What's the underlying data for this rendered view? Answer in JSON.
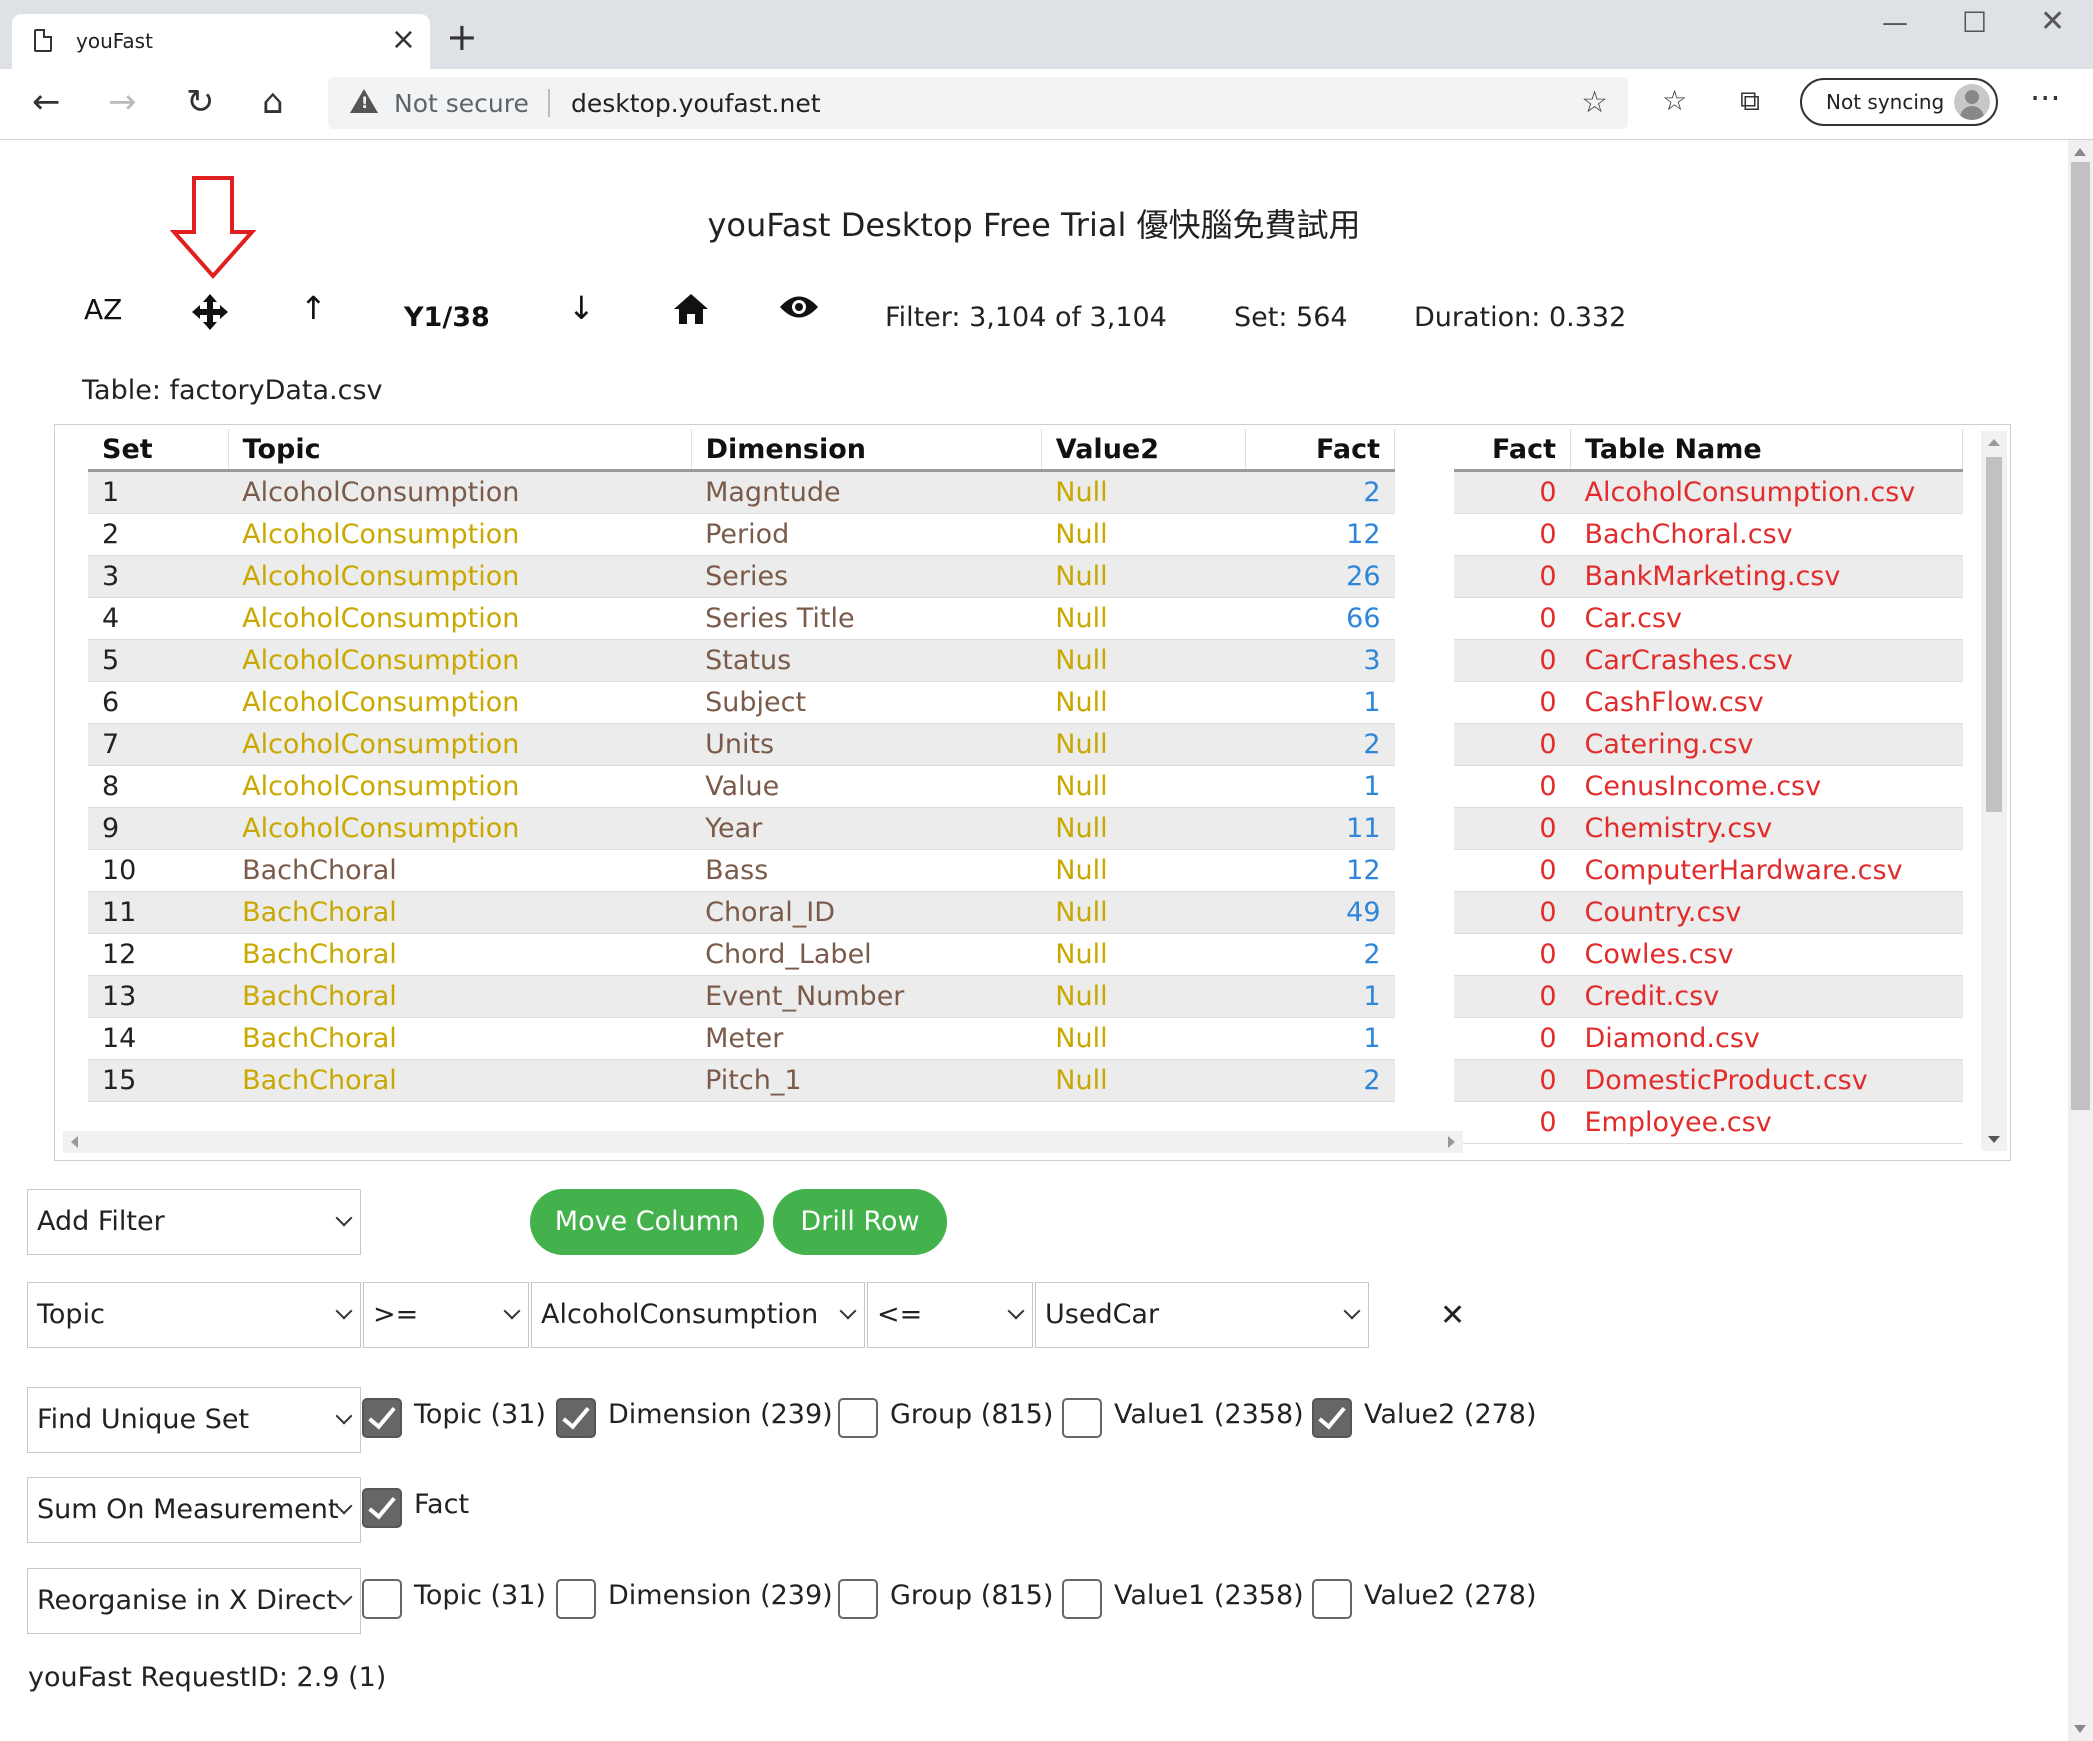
{
  "browser": {
    "tab_title": "youFast",
    "not_secure": "Not secure",
    "url": "desktop.youfast.net",
    "sync_label": "Not syncing"
  },
  "page": {
    "title": "youFast Desktop Free Trial 優快腦免費試用",
    "toolbar": {
      "az_label": "AZ",
      "position": "Y1/38",
      "filter": "Filter: 3,104 of 3,104",
      "set": "Set: 564",
      "duration": "Duration: 0.332"
    },
    "table_label": "Table: factoryData.csv"
  },
  "grid": {
    "headers": [
      "Set",
      "Topic",
      "Dimension",
      "Value2",
      "Fact"
    ],
    "rows": [
      {
        "set": "1",
        "topic": "AlcoholConsumption",
        "dimension": "Magntude",
        "value2": "Null",
        "fact": "2",
        "first": true
      },
      {
        "set": "2",
        "topic": "AlcoholConsumption",
        "dimension": "Period",
        "value2": "Null",
        "fact": "12"
      },
      {
        "set": "3",
        "topic": "AlcoholConsumption",
        "dimension": "Series",
        "value2": "Null",
        "fact": "26"
      },
      {
        "set": "4",
        "topic": "AlcoholConsumption",
        "dimension": "Series Title",
        "value2": "Null",
        "fact": "66"
      },
      {
        "set": "5",
        "topic": "AlcoholConsumption",
        "dimension": "Status",
        "value2": "Null",
        "fact": "3"
      },
      {
        "set": "6",
        "topic": "AlcoholConsumption",
        "dimension": "Subject",
        "value2": "Null",
        "fact": "1"
      },
      {
        "set": "7",
        "topic": "AlcoholConsumption",
        "dimension": "Units",
        "value2": "Null",
        "fact": "2"
      },
      {
        "set": "8",
        "topic": "AlcoholConsumption",
        "dimension": "Value",
        "value2": "Null",
        "fact": "1"
      },
      {
        "set": "9",
        "topic": "AlcoholConsumption",
        "dimension": "Year",
        "value2": "Null",
        "fact": "11"
      },
      {
        "set": "10",
        "topic": "BachChoral",
        "dimension": "Bass",
        "value2": "Null",
        "fact": "12",
        "first": true
      },
      {
        "set": "11",
        "topic": "BachChoral",
        "dimension": "Choral_ID",
        "value2": "Null",
        "fact": "49"
      },
      {
        "set": "12",
        "topic": "BachChoral",
        "dimension": "Chord_Label",
        "value2": "Null",
        "fact": "2"
      },
      {
        "set": "13",
        "topic": "BachChoral",
        "dimension": "Event_Number",
        "value2": "Null",
        "fact": "1"
      },
      {
        "set": "14",
        "topic": "BachChoral",
        "dimension": "Meter",
        "value2": "Null",
        "fact": "1"
      },
      {
        "set": "15",
        "topic": "BachChoral",
        "dimension": "Pitch_1",
        "value2": "Null",
        "fact": "2"
      }
    ]
  },
  "tables": {
    "headers": [
      "Fact",
      "Table Name"
    ],
    "rows": [
      {
        "fact": "0",
        "name": "AlcoholConsumption.csv"
      },
      {
        "fact": "0",
        "name": "BachChoral.csv"
      },
      {
        "fact": "0",
        "name": "BankMarketing.csv"
      },
      {
        "fact": "0",
        "name": "Car.csv"
      },
      {
        "fact": "0",
        "name": "CarCrashes.csv"
      },
      {
        "fact": "0",
        "name": "CashFlow.csv"
      },
      {
        "fact": "0",
        "name": "Catering.csv"
      },
      {
        "fact": "0",
        "name": "CenusIncome.csv"
      },
      {
        "fact": "0",
        "name": "Chemistry.csv"
      },
      {
        "fact": "0",
        "name": "ComputerHardware.csv"
      },
      {
        "fact": "0",
        "name": "Country.csv"
      },
      {
        "fact": "0",
        "name": "Cowles.csv"
      },
      {
        "fact": "0",
        "name": "Credit.csv"
      },
      {
        "fact": "0",
        "name": "Diamond.csv"
      },
      {
        "fact": "0",
        "name": "DomesticProduct.csv"
      },
      {
        "fact": "0",
        "name": "Employee.csv"
      }
    ]
  },
  "controls": {
    "add_filter": "Add Filter",
    "move_column": "Move Column",
    "drill_row": "Drill Row",
    "filter_field": "Topic",
    "op1": ">=",
    "value1": "AlcoholConsumption",
    "op2": "<=",
    "value2": "UsedCar",
    "close": "✕",
    "find_unique_set": "Find Unique Set",
    "unique_options": [
      {
        "label": "Topic (31)",
        "checked": true
      },
      {
        "label": "Dimension (239)",
        "checked": true
      },
      {
        "label": "Group (815)",
        "checked": false
      },
      {
        "label": "Value1 (2358)",
        "checked": false
      },
      {
        "label": "Value2 (278)",
        "checked": true
      }
    ],
    "sum_on": "Sum On Measurement",
    "sum_options": [
      {
        "label": "Fact",
        "checked": true
      }
    ],
    "reorganise": "Reorganise in X Direct",
    "reorg_options": [
      {
        "label": "Topic (31)",
        "checked": false
      },
      {
        "label": "Dimension (239)",
        "checked": false
      },
      {
        "label": "Group (815)",
        "checked": false
      },
      {
        "label": "Value1 (2358)",
        "checked": false
      },
      {
        "label": "Value2 (278)",
        "checked": false
      }
    ]
  },
  "request_id": "youFast RequestID: 2.9 (1)",
  "colors": {
    "green": "#44b24c",
    "gold": "#c9a800",
    "blue": "#2f86d9",
    "red": "#e22c2c",
    "brown": "#7a5b4a"
  }
}
